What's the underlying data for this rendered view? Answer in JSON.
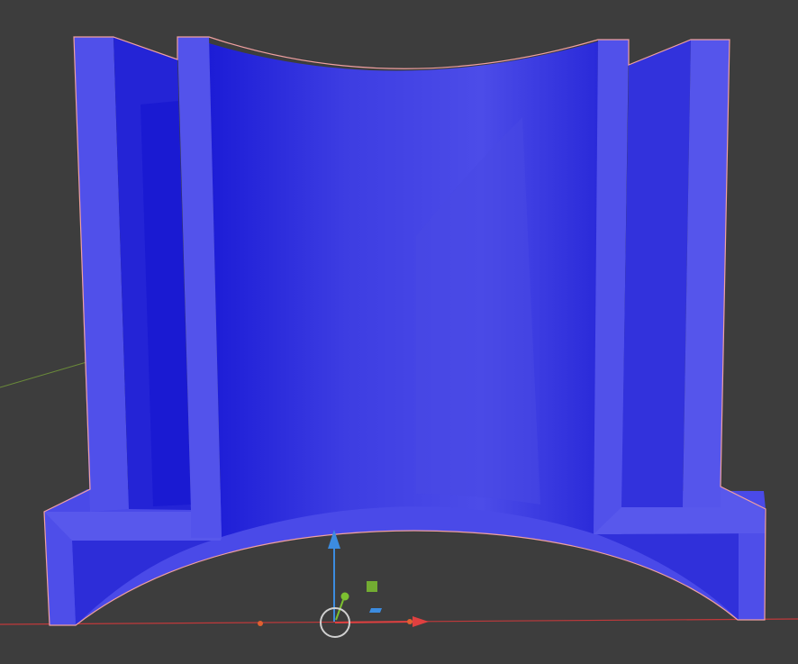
{
  "viewport": {
    "background_color": "#3d3d3d",
    "grid_x_axis_color": "#c0393b",
    "grid_y_axis_color": "#6a8a3a"
  },
  "object": {
    "fill_base": "#4848e6",
    "fill_dark": "#2323d8",
    "fill_light": "#5a5af0",
    "outline_color": "#f0a0a0",
    "selected": true
  },
  "gizmo": {
    "x_axis_color": "#e04040",
    "y_axis_color": "#7cc030",
    "z_axis_color": "#3c8ce0",
    "origin_color": "#d0d0d0",
    "icons": [
      "x-arrow-icon",
      "y-arrow-icon",
      "z-arrow-icon",
      "origin-circle-icon",
      "plane-xz-handle-icon",
      "plane-xy-handle-icon"
    ]
  }
}
